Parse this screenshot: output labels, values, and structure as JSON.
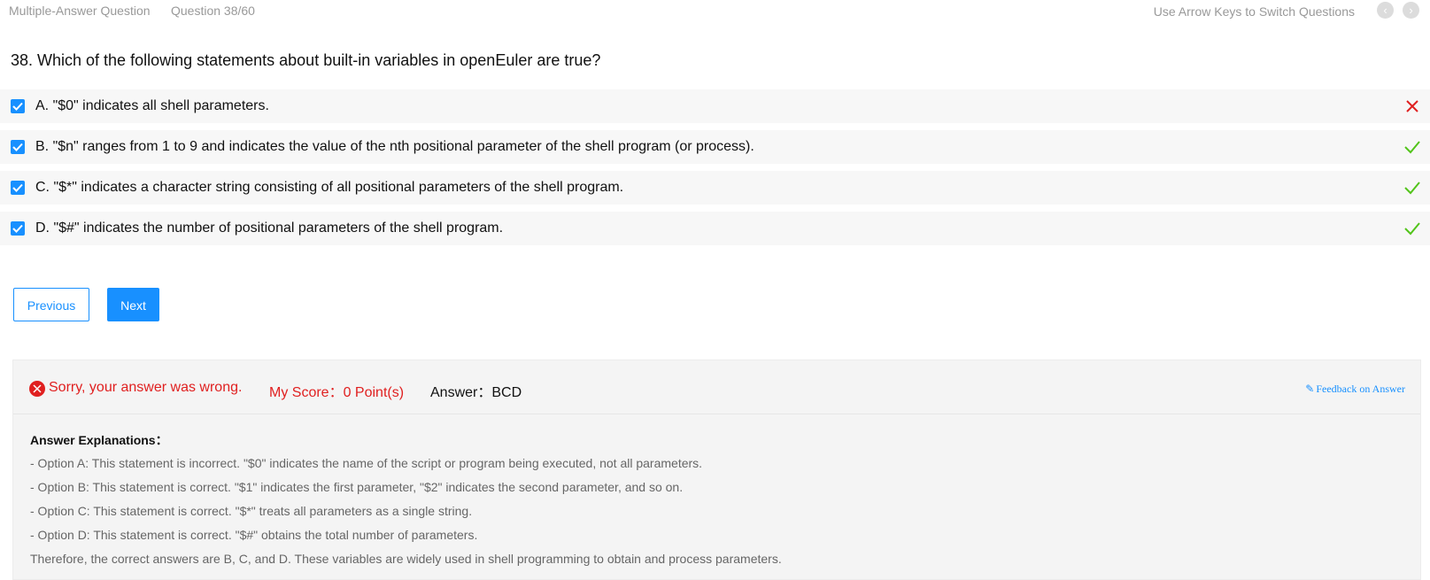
{
  "topbar": {
    "question_type": "Multiple-Answer Question",
    "question_counter": "Question 38/60",
    "keyboard_hint": "Use Arrow Keys to Switch Questions",
    "prev_icon": "chevron-left-icon",
    "next_icon": "chevron-right-icon"
  },
  "question": {
    "text": "38. Which of the following statements about built-in variables in openEuler are true?"
  },
  "options": [
    {
      "text": "A. \"$0\" indicates all shell parameters.",
      "checked": true,
      "result": "wrong"
    },
    {
      "text": "B. \"$n\" ranges from 1 to 9 and indicates the value of the nth positional parameter of the shell program (or process).",
      "checked": true,
      "result": "correct"
    },
    {
      "text": "C. \"$*\" indicates a character string consisting of all positional parameters of the shell program.",
      "checked": true,
      "result": "correct"
    },
    {
      "text": "D. \"$#\" indicates the number of positional parameters of the shell program.",
      "checked": true,
      "result": "correct"
    }
  ],
  "buttons": {
    "previous": "Previous",
    "next": "Next"
  },
  "result": {
    "status": "Sorry, your answer was wrong.",
    "score": "My Score：0 Point(s)",
    "answer": "Answer：BCD",
    "feedback_link": "Feedback on Answer",
    "explanation_title": "Answer Explanations：",
    "explanation_lines": [
      "- Option A: This statement is incorrect. \"$0\" indicates the name of the script or program being executed, not all parameters.",
      "- Option B: This statement is correct. \"$1\" indicates the first parameter, \"$2\" indicates the second parameter, and so on.",
      "- Option C: This statement is correct. \"$*\" treats all parameters as a single string.",
      "- Option D: This statement is correct. \"$#\" obtains the total number of parameters.",
      "Therefore, the correct answers are B, C, and D. These variables are widely used in shell programming to obtain and process parameters."
    ]
  },
  "colors": {
    "accent": "#1890ff",
    "error": "#e02020",
    "success": "#52c41a"
  }
}
